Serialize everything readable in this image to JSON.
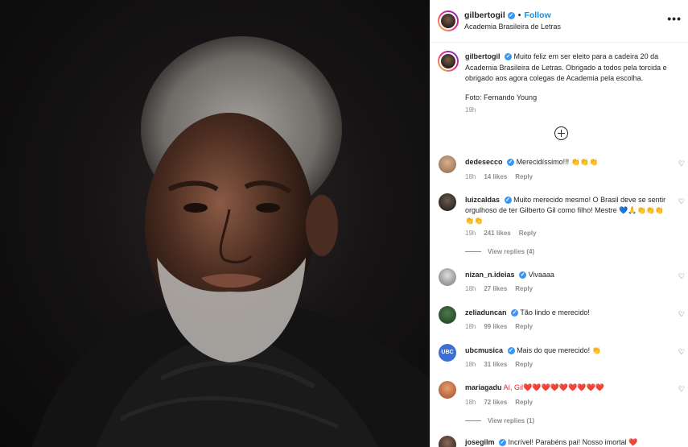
{
  "header": {
    "username": "gilbertogil",
    "separator": "•",
    "follow_label": "Follow",
    "location": "Academia Brasileira de Letras",
    "more": "•••"
  },
  "caption": {
    "username": "gilbertogil",
    "text": "Muito feliz em ser eleito para a cadeira 20 da Academia Brasileira de Letras. Obrigado a todos pela torcida e obrigado aos agora colegas de Academia pela escolha.",
    "photo_credit": "Foto: Fernando Young",
    "time": "19h"
  },
  "comments": [
    {
      "username": "dedesecco",
      "text": "Merecidíssimo!!! 👏👏👏",
      "time": "18h",
      "likes": "14 likes",
      "reply": "Reply"
    },
    {
      "username": "luizcaldas",
      "text": "Muito merecido mesmo! O Brasil deve se sentir orgulhoso de ter Gilberto Gil como filho! Mestre 💙🙏👏👏👏👏👏",
      "time": "19h",
      "likes": "241 likes",
      "reply": "Reply",
      "view_replies": "View replies (4)"
    },
    {
      "username": "nizan_n.ideias",
      "text": "Vivaaaa",
      "time": "18h",
      "likes": "27 likes",
      "reply": "Reply"
    },
    {
      "username": "zeliaduncan",
      "text": "Tão lindo e merecido!",
      "time": "18h",
      "likes": "99 likes",
      "reply": "Reply"
    },
    {
      "username": "ubcmusica",
      "text": "Mais do que merecido! 👏",
      "time": "18h",
      "likes": "31 likes",
      "reply": "Reply",
      "avatar_text": "UBC"
    },
    {
      "username": "mariagadu",
      "text": "Aí, Gil❤️❤️❤️❤️❤️❤️❤️❤️❤️",
      "time": "18h",
      "likes": "72 likes",
      "reply": "Reply",
      "view_replies": "View replies (1)"
    },
    {
      "username": "josegilm",
      "text": "Incrível! Parabéns pai! Nosso imortal ❤️",
      "time": "",
      "likes": "",
      "reply": ""
    }
  ],
  "icons": {
    "heart": "♡",
    "verified": "✓"
  }
}
